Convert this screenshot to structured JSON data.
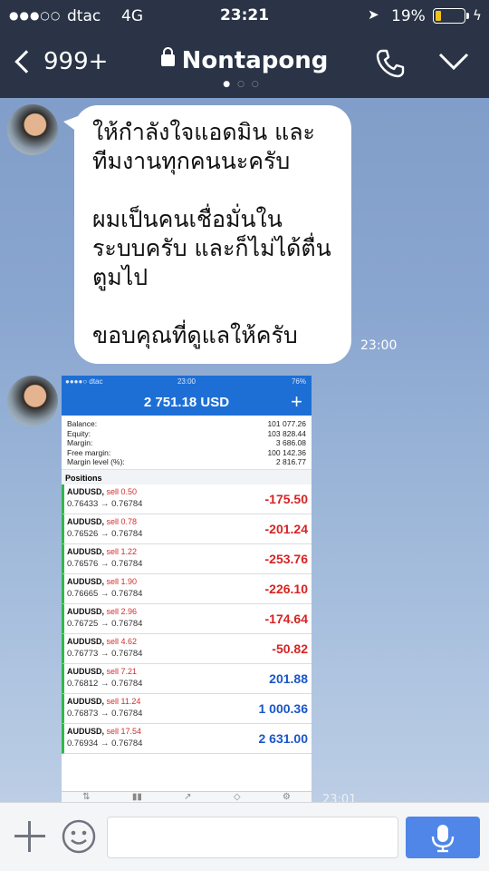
{
  "status_bar": {
    "signal": "●●●○○",
    "carrier": "dtac",
    "network": "4G",
    "time": "23:21",
    "battery_percent": "19%",
    "battery_level": 0.19
  },
  "header": {
    "back_label": "999+",
    "contact_name": "Nontapong"
  },
  "messages": [
    {
      "text": "ให้กำลังใจแอดมิน และ\nทีมงานทุกคนนะครับ\n\nผมเป็นคนเชื่อมั่นใน\nระบบครับ และก็ไม่ได้ตื่น\nตูมไป\n\nขอบคุณที่ดูแลให้ครับ",
      "time": "23:00"
    },
    {
      "type": "image",
      "time": "23:01",
      "screenshot": {
        "status_left": "●●●●○ dtac",
        "status_time": "23:00",
        "status_right": "76%",
        "total": "2 751.18 USD",
        "plus": "+",
        "account": [
          {
            "label": "Balance:",
            "value": "101 077.26"
          },
          {
            "label": "Equity:",
            "value": "103 828.44"
          },
          {
            "label": "Margin:",
            "value": "3 686.08"
          },
          {
            "label": "Free margin:",
            "value": "100 142.36"
          },
          {
            "label": "Margin level (%):",
            "value": "2 816.77"
          }
        ],
        "positions_label": "Positions",
        "positions": [
          {
            "symbol": "AUDUSD,",
            "side": "sell 0.50",
            "prices": "0.76433 → 0.76784",
            "pl": "-175.50"
          },
          {
            "symbol": "AUDUSD,",
            "side": "sell 0.78",
            "prices": "0.76526 → 0.76784",
            "pl": "-201.24"
          },
          {
            "symbol": "AUDUSD,",
            "side": "sell 1.22",
            "prices": "0.76576 → 0.76784",
            "pl": "-253.76"
          },
          {
            "symbol": "AUDUSD,",
            "side": "sell 1.90",
            "prices": "0.76665 → 0.76784",
            "pl": "-226.10"
          },
          {
            "symbol": "AUDUSD,",
            "side": "sell 2.96",
            "prices": "0.76725 → 0.76784",
            "pl": "-174.64"
          },
          {
            "symbol": "AUDUSD,",
            "side": "sell 4.62",
            "prices": "0.76773 → 0.76784",
            "pl": "-50.82"
          },
          {
            "symbol": "AUDUSD,",
            "side": "sell 7.21",
            "prices": "0.76812 → 0.76784",
            "pl": "201.88"
          },
          {
            "symbol": "AUDUSD,",
            "side": "sell 11.24",
            "prices": "0.76873 → 0.76784",
            "pl": "1 000.36"
          },
          {
            "symbol": "AUDUSD,",
            "side": "sell 17.54",
            "prices": "0.76934 → 0.76784",
            "pl": "2 631.00"
          }
        ]
      }
    }
  ],
  "input_bar": {
    "placeholder": ""
  },
  "colors": {
    "header_bg": "#2a3446",
    "send_mic_bg": "#4f86e8",
    "loss": "#d62424",
    "profit": "#1a56c9"
  },
  "icons": [
    "back-chevron-icon",
    "lock-icon",
    "phone-icon",
    "chevron-down-icon",
    "plus-icon",
    "emoji-icon",
    "microphone-icon"
  ]
}
